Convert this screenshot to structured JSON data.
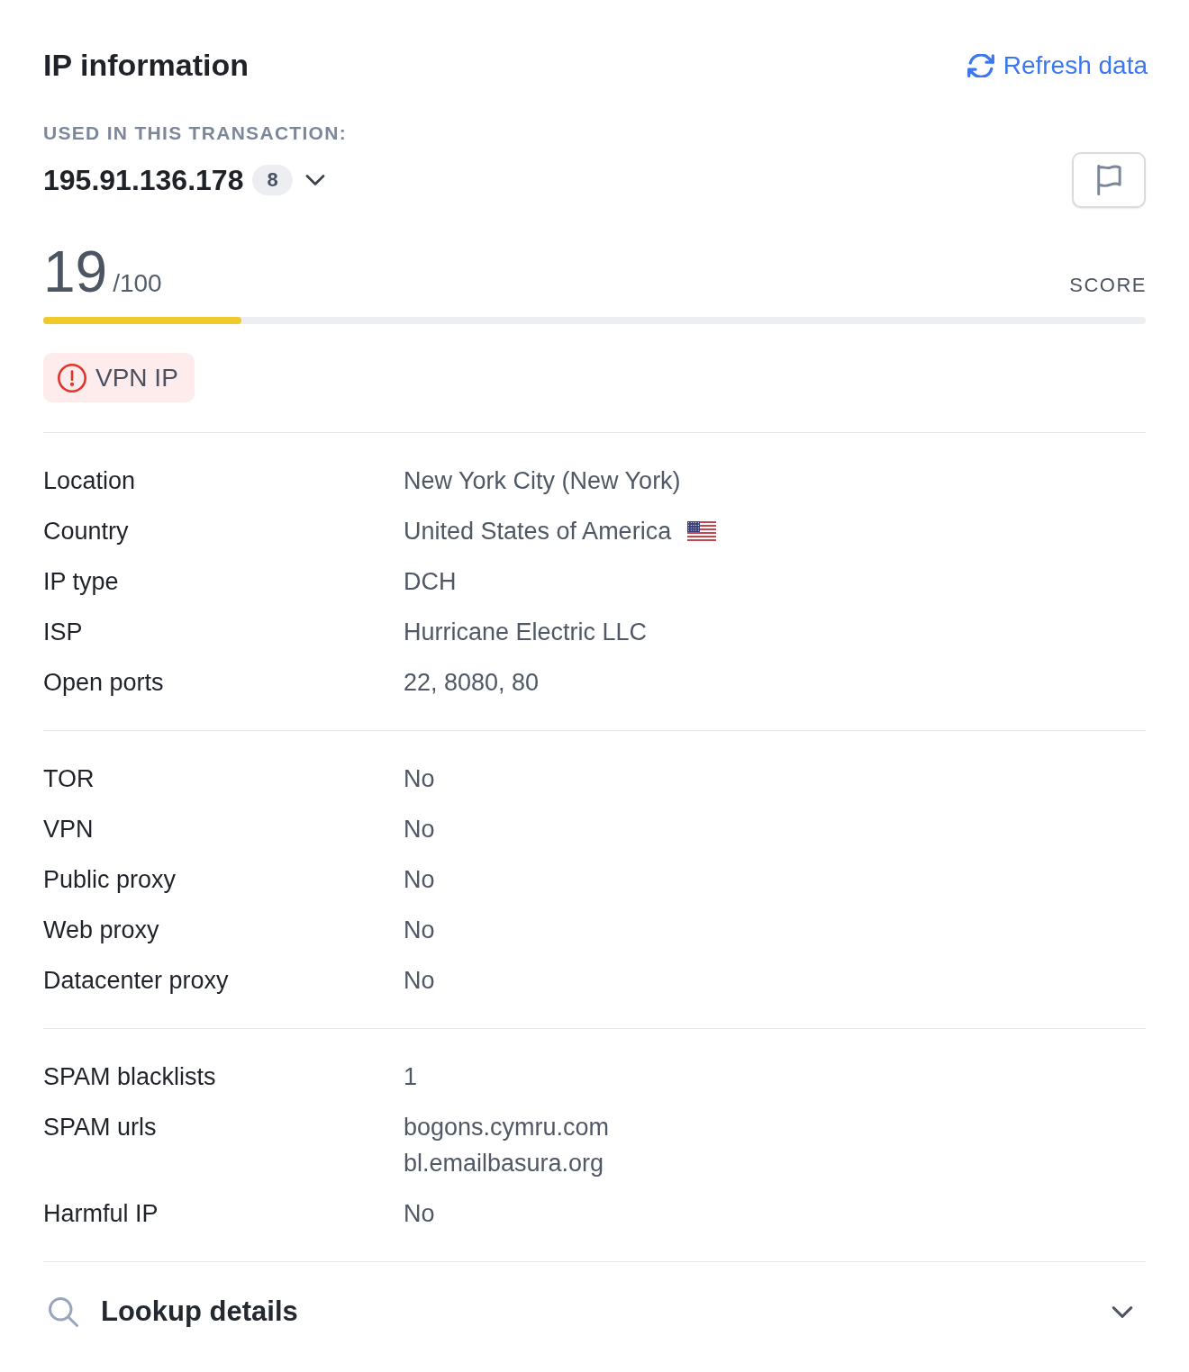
{
  "header": {
    "title": "IP information",
    "refresh_label": "Refresh data"
  },
  "ip": {
    "caption": "USED IN THIS TRANSACTION:",
    "address": "195.91.136.178",
    "count": "8"
  },
  "score": {
    "value": "19",
    "max": "/100",
    "label": "SCORE",
    "level": 0.18
  },
  "tags": [
    {
      "kind": "warning",
      "label": "VPN IP"
    }
  ],
  "sections": [
    {
      "rows": [
        {
          "kind": "text",
          "label": "Location",
          "values": [
            "New York City (New York)"
          ]
        },
        {
          "kind": "country",
          "label": "Country",
          "values": [
            "United States of America"
          ]
        },
        {
          "kind": "text",
          "label": "IP type",
          "values": [
            "DCH"
          ]
        },
        {
          "kind": "text",
          "label": "ISP",
          "values": [
            "Hurricane Electric LLC"
          ]
        },
        {
          "kind": "text",
          "label": "Open ports",
          "values": [
            "22, 8080, 80"
          ]
        }
      ]
    },
    {
      "rows": [
        {
          "kind": "text",
          "label": "TOR",
          "values": [
            "No"
          ]
        },
        {
          "kind": "text",
          "label": "VPN",
          "values": [
            "No"
          ]
        },
        {
          "kind": "text",
          "label": "Public proxy",
          "values": [
            "No"
          ]
        },
        {
          "kind": "text",
          "label": "Web proxy",
          "values": [
            "No"
          ]
        },
        {
          "kind": "text",
          "label": "Datacenter proxy",
          "values": [
            "No"
          ]
        }
      ]
    },
    {
      "rows": [
        {
          "kind": "text",
          "label": "SPAM blacklists",
          "values": [
            "1"
          ]
        },
        {
          "kind": "text",
          "label": "SPAM urls",
          "values": [
            "bogons.cymru.com",
            "bl.emailbasura.org"
          ]
        },
        {
          "kind": "text",
          "label": "Harmful IP",
          "values": [
            "No"
          ]
        }
      ]
    }
  ],
  "lookup": {
    "title": "Lookup details",
    "expanded": false
  }
}
